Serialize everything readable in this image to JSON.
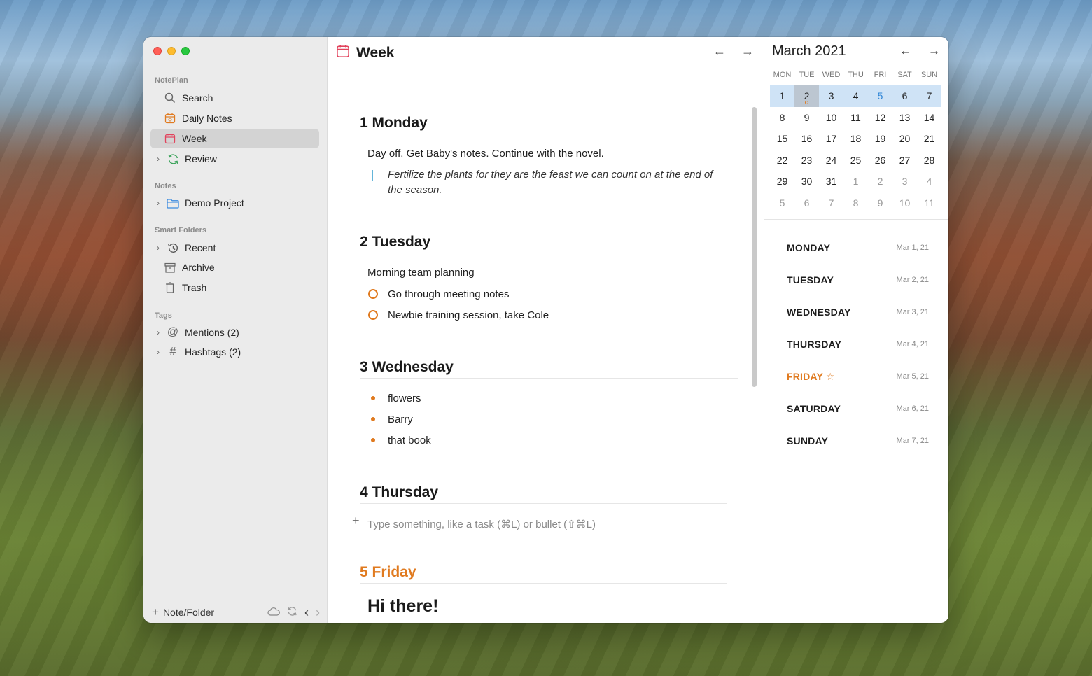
{
  "sidebar": {
    "section_noteplan": "NotePlan",
    "search": "Search",
    "daily_notes": "Daily Notes",
    "week": "Week",
    "review": "Review",
    "section_notes": "Notes",
    "demo_project": "Demo Project",
    "section_smart": "Smart Folders",
    "recent": "Recent",
    "archive": "Archive",
    "trash": "Trash",
    "section_tags": "Tags",
    "mentions": "Mentions (2)",
    "hashtags": "Hashtags (2)",
    "footer_add": "Note/Folder"
  },
  "main": {
    "title": "Week",
    "days": [
      {
        "heading": "1 Monday"
      },
      {
        "heading": "2 Tuesday"
      },
      {
        "heading": "3 Wednesday"
      },
      {
        "heading": "4 Thursday"
      },
      {
        "heading": "5 Friday"
      }
    ],
    "monday_text": "Day off. Get Baby's notes. Continue with the novel.",
    "monday_quote": "Fertilize the plants for they are the feast we can count on at the end of the season.",
    "tuesday_text": "Morning team planning",
    "tuesday_tasks": [
      "Go through meeting notes",
      "Newbie training session, take Cole"
    ],
    "wednesday_bullets": [
      "flowers",
      "Barry",
      "that book"
    ],
    "thursday_placeholder": "Type something, like a task (⌘L) or bullet (⇧⌘L)",
    "friday_text": "Hi there!"
  },
  "calendar": {
    "month": "March 2021",
    "weekdays": [
      "MON",
      "TUE",
      "WED",
      "THU",
      "FRI",
      "SAT",
      "SUN"
    ],
    "rows": [
      [
        "1",
        "2",
        "3",
        "4",
        "5",
        "6",
        "7"
      ],
      [
        "8",
        "9",
        "10",
        "11",
        "12",
        "13",
        "14"
      ],
      [
        "15",
        "16",
        "17",
        "18",
        "19",
        "20",
        "21"
      ],
      [
        "22",
        "23",
        "24",
        "25",
        "26",
        "27",
        "28"
      ],
      [
        "29",
        "30",
        "31",
        "1",
        "2",
        "3",
        "4"
      ],
      [
        "5",
        "6",
        "7",
        "8",
        "9",
        "10",
        "11"
      ]
    ]
  },
  "week_list": [
    {
      "day": "MONDAY",
      "date": "Mar 1, 21"
    },
    {
      "day": "TUESDAY",
      "date": "Mar 2, 21"
    },
    {
      "day": "WEDNESDAY",
      "date": "Mar 3, 21"
    },
    {
      "day": "THURSDAY",
      "date": "Mar 4, 21"
    },
    {
      "day": "FRIDAY",
      "date": "Mar 5, 21"
    },
    {
      "day": "SATURDAY",
      "date": "Mar 6, 21"
    },
    {
      "day": "SUNDAY",
      "date": "Mar 7, 21"
    }
  ],
  "colors": {
    "accent": "#e07a1f",
    "week_highlight": "#cfe3f6",
    "today_blue": "#2d84d6"
  }
}
